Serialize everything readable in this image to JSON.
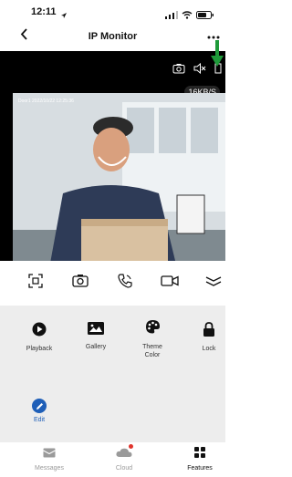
{
  "status_bar": {
    "time": "12:11"
  },
  "nav": {
    "title": "IP Monitor"
  },
  "video": {
    "speed": "16KB/S",
    "overlay": "Door1 2022/10/22 12:25:36"
  },
  "features": [
    {
      "label": "Playback"
    },
    {
      "label": "Gallery"
    },
    {
      "label": "Theme Color"
    },
    {
      "label": "Lock"
    }
  ],
  "edit": {
    "label": "Edit"
  },
  "tabs": {
    "messages": "Messages",
    "cloud": "Cloud",
    "features": "Features"
  },
  "colors": {
    "accent": "#1f5fb8",
    "arrow": "#1f9a3a"
  }
}
